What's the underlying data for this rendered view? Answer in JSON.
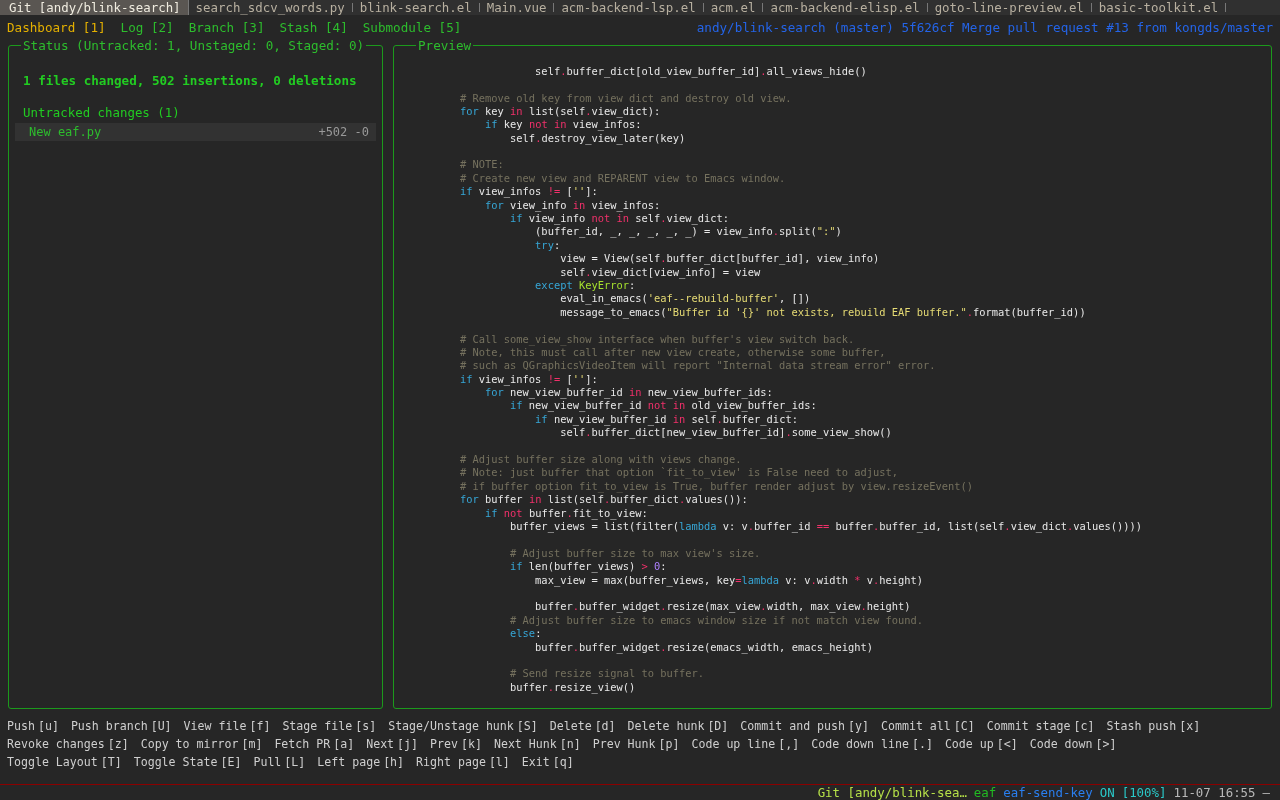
{
  "tabs": [
    {
      "label": "Git [andy/blink-search]",
      "selected": true
    },
    {
      "label": "search_sdcv_words.py",
      "selected": false
    },
    {
      "label": "blink-search.el",
      "selected": false
    },
    {
      "label": "Main.vue",
      "selected": false
    },
    {
      "label": "acm-backend-lsp.el",
      "selected": false
    },
    {
      "label": "acm.el",
      "selected": false
    },
    {
      "label": "acm-backend-elisp.el",
      "selected": false
    },
    {
      "label": "goto-line-preview.el",
      "selected": false
    },
    {
      "label": "basic-toolkit.el",
      "selected": false
    }
  ],
  "menu": [
    {
      "label": "Dashboard [1]",
      "selected": true
    },
    {
      "label": "Log [2]",
      "selected": false
    },
    {
      "label": "Branch [3]",
      "selected": false
    },
    {
      "label": "Stash [4]",
      "selected": false
    },
    {
      "label": "Submodule [5]",
      "selected": false
    }
  ],
  "commit_info": "andy/blink-search (master) 5f626cf Merge pull request #13 from kongds/master",
  "status": {
    "title": "Status (Untracked: 1, Unstaged: 0, Staged: 0)",
    "summary": "1 files changed, 502 insertions, 0 deletions",
    "sections": [
      {
        "heading": "Untracked changes (1)",
        "files": [
          {
            "name": "New eaf.py",
            "stat": "+502 -0",
            "selected": true
          }
        ]
      }
    ]
  },
  "preview": {
    "title": "Preview",
    "lines": [
      {
        "kind": "code",
        "tokens": [
          {
            "t": "                    self",
            "kind": "plain"
          },
          {
            "t": ".",
            "kind": "operator"
          },
          {
            "t": "buffer_dict[old_view_buffer_id]",
            "kind": "plain"
          },
          {
            "t": ".",
            "kind": "operator"
          },
          {
            "t": "all_views_hide()",
            "kind": "plain"
          }
        ]
      },
      {
        "kind": "blank"
      },
      {
        "kind": "code",
        "tokens": [
          {
            "t": "        # Remove old key from view dict and destroy old view.",
            "kind": "comment"
          }
        ]
      },
      {
        "kind": "code",
        "tokens": [
          {
            "t": "        for",
            "kind": "keyword"
          },
          {
            "t": " key ",
            "kind": "plain"
          },
          {
            "t": "in",
            "kind": "operator"
          },
          {
            "t": " list(self",
            "kind": "plain"
          },
          {
            "t": ".",
            "kind": "operator"
          },
          {
            "t": "view_dict):",
            "kind": "plain"
          }
        ]
      },
      {
        "kind": "code",
        "tokens": [
          {
            "t": "            if",
            "kind": "keyword"
          },
          {
            "t": " key ",
            "kind": "plain"
          },
          {
            "t": "not in",
            "kind": "operator"
          },
          {
            "t": " view_infos:",
            "kind": "plain"
          }
        ]
      },
      {
        "kind": "code",
        "tokens": [
          {
            "t": "                self",
            "kind": "plain"
          },
          {
            "t": ".",
            "kind": "operator"
          },
          {
            "t": "destroy_view_later(key)",
            "kind": "plain"
          }
        ]
      },
      {
        "kind": "blank"
      },
      {
        "kind": "code",
        "tokens": [
          {
            "t": "        # NOTE:",
            "kind": "comment"
          }
        ]
      },
      {
        "kind": "code",
        "tokens": [
          {
            "t": "        # Create new view and REPARENT view to Emacs window.",
            "kind": "comment"
          }
        ]
      },
      {
        "kind": "code",
        "tokens": [
          {
            "t": "        if",
            "kind": "keyword"
          },
          {
            "t": " view_infos ",
            "kind": "plain"
          },
          {
            "t": "!=",
            "kind": "operator"
          },
          {
            "t": " [",
            "kind": "plain"
          },
          {
            "t": "''",
            "kind": "string"
          },
          {
            "t": "]:",
            "kind": "plain"
          }
        ]
      },
      {
        "kind": "code",
        "tokens": [
          {
            "t": "            for",
            "kind": "keyword"
          },
          {
            "t": " view_info ",
            "kind": "plain"
          },
          {
            "t": "in",
            "kind": "operator"
          },
          {
            "t": " view_infos:",
            "kind": "plain"
          }
        ]
      },
      {
        "kind": "code",
        "tokens": [
          {
            "t": "                if",
            "kind": "keyword"
          },
          {
            "t": " view_info ",
            "kind": "plain"
          },
          {
            "t": "not in",
            "kind": "operator"
          },
          {
            "t": " self",
            "kind": "plain"
          },
          {
            "t": ".",
            "kind": "operator"
          },
          {
            "t": "view_dict:",
            "kind": "plain"
          }
        ]
      },
      {
        "kind": "code",
        "tokens": [
          {
            "t": "                    (buffer_id, _, _, _, _, _) = view_info",
            "kind": "plain"
          },
          {
            "t": ".",
            "kind": "operator"
          },
          {
            "t": "split(",
            "kind": "plain"
          },
          {
            "t": "\":\"",
            "kind": "string"
          },
          {
            "t": ")",
            "kind": "plain"
          }
        ]
      },
      {
        "kind": "code",
        "tokens": [
          {
            "t": "                    try",
            "kind": "keyword"
          },
          {
            "t": ":",
            "kind": "plain"
          }
        ]
      },
      {
        "kind": "code",
        "tokens": [
          {
            "t": "                        view = View(self",
            "kind": "plain"
          },
          {
            "t": ".",
            "kind": "operator"
          },
          {
            "t": "buffer_dict[buffer_id], view_info)",
            "kind": "plain"
          }
        ]
      },
      {
        "kind": "code",
        "tokens": [
          {
            "t": "                        self",
            "kind": "plain"
          },
          {
            "t": ".",
            "kind": "operator"
          },
          {
            "t": "view_dict[view_info] = view",
            "kind": "plain"
          }
        ]
      },
      {
        "kind": "code",
        "tokens": [
          {
            "t": "                    except ",
            "kind": "keyword"
          },
          {
            "t": "KeyError",
            "kind": "type"
          },
          {
            "t": ":",
            "kind": "plain"
          }
        ]
      },
      {
        "kind": "code",
        "tokens": [
          {
            "t": "                        eval_in_emacs(",
            "kind": "plain"
          },
          {
            "t": "'eaf--rebuild-buffer'",
            "kind": "string"
          },
          {
            "t": ", [])",
            "kind": "plain"
          }
        ]
      },
      {
        "kind": "code",
        "tokens": [
          {
            "t": "                        message_to_emacs(",
            "kind": "plain"
          },
          {
            "t": "\"Buffer id '{}' not exists, rebuild EAF buffer.\"",
            "kind": "string"
          },
          {
            "t": ".",
            "kind": "operator"
          },
          {
            "t": "format(buffer_id))",
            "kind": "plain"
          }
        ]
      },
      {
        "kind": "blank"
      },
      {
        "kind": "code",
        "tokens": [
          {
            "t": "        # Call some_view_show interface when buffer's view switch back.",
            "kind": "comment"
          }
        ]
      },
      {
        "kind": "code",
        "tokens": [
          {
            "t": "        # Note, this must call after new view create, otherwise some buffer,",
            "kind": "comment"
          }
        ]
      },
      {
        "kind": "code",
        "tokens": [
          {
            "t": "        # such as QGraphicsVideoItem will report \"Internal data stream error\" error.",
            "kind": "comment"
          }
        ]
      },
      {
        "kind": "code",
        "tokens": [
          {
            "t": "        if",
            "kind": "keyword"
          },
          {
            "t": " view_infos ",
            "kind": "plain"
          },
          {
            "t": "!=",
            "kind": "operator"
          },
          {
            "t": " [",
            "kind": "plain"
          },
          {
            "t": "''",
            "kind": "string"
          },
          {
            "t": "]:",
            "kind": "plain"
          }
        ]
      },
      {
        "kind": "code",
        "tokens": [
          {
            "t": "            for",
            "kind": "keyword"
          },
          {
            "t": " new_view_buffer_id ",
            "kind": "plain"
          },
          {
            "t": "in",
            "kind": "operator"
          },
          {
            "t": " new_view_buffer_ids:",
            "kind": "plain"
          }
        ]
      },
      {
        "kind": "code",
        "tokens": [
          {
            "t": "                if",
            "kind": "keyword"
          },
          {
            "t": " new_view_buffer_id ",
            "kind": "plain"
          },
          {
            "t": "not in",
            "kind": "operator"
          },
          {
            "t": " old_view_buffer_ids:",
            "kind": "plain"
          }
        ]
      },
      {
        "kind": "code",
        "tokens": [
          {
            "t": "                    if",
            "kind": "keyword"
          },
          {
            "t": " new_view_buffer_id ",
            "kind": "plain"
          },
          {
            "t": "in",
            "kind": "operator"
          },
          {
            "t": " self",
            "kind": "plain"
          },
          {
            "t": ".",
            "kind": "operator"
          },
          {
            "t": "buffer_dict:",
            "kind": "plain"
          }
        ]
      },
      {
        "kind": "code",
        "tokens": [
          {
            "t": "                        self",
            "kind": "plain"
          },
          {
            "t": ".",
            "kind": "operator"
          },
          {
            "t": "buffer_dict[new_view_buffer_id]",
            "kind": "plain"
          },
          {
            "t": ".",
            "kind": "operator"
          },
          {
            "t": "some_view_show()",
            "kind": "plain"
          }
        ]
      },
      {
        "kind": "blank"
      },
      {
        "kind": "code",
        "tokens": [
          {
            "t": "        # Adjust buffer size along with views change.",
            "kind": "comment"
          }
        ]
      },
      {
        "kind": "code",
        "tokens": [
          {
            "t": "        # Note: just buffer that option `fit_to_view' is False need to adjust,",
            "kind": "comment"
          }
        ]
      },
      {
        "kind": "code",
        "tokens": [
          {
            "t": "        # if buffer option fit_to_view is True, buffer render adjust by view.resizeEvent()",
            "kind": "comment"
          }
        ]
      },
      {
        "kind": "code",
        "tokens": [
          {
            "t": "        for",
            "kind": "keyword"
          },
          {
            "t": " buffer ",
            "kind": "plain"
          },
          {
            "t": "in",
            "kind": "operator"
          },
          {
            "t": " list(self",
            "kind": "plain"
          },
          {
            "t": ".",
            "kind": "operator"
          },
          {
            "t": "buffer_dict",
            "kind": "plain"
          },
          {
            "t": ".",
            "kind": "operator"
          },
          {
            "t": "values()):",
            "kind": "plain"
          }
        ]
      },
      {
        "kind": "code",
        "tokens": [
          {
            "t": "            if ",
            "kind": "keyword"
          },
          {
            "t": "not",
            "kind": "operator"
          },
          {
            "t": " buffer",
            "kind": "plain"
          },
          {
            "t": ".",
            "kind": "operator"
          },
          {
            "t": "fit_to_view:",
            "kind": "plain"
          }
        ]
      },
      {
        "kind": "code",
        "tokens": [
          {
            "t": "                buffer_views = list(filter(",
            "kind": "plain"
          },
          {
            "t": "lambda",
            "kind": "keyword"
          },
          {
            "t": " v: v",
            "kind": "plain"
          },
          {
            "t": ".",
            "kind": "operator"
          },
          {
            "t": "buffer_id ",
            "kind": "plain"
          },
          {
            "t": "==",
            "kind": "operator"
          },
          {
            "t": " buffer",
            "kind": "plain"
          },
          {
            "t": ".",
            "kind": "operator"
          },
          {
            "t": "buffer_id, list(self",
            "kind": "plain"
          },
          {
            "t": ".",
            "kind": "operator"
          },
          {
            "t": "view_dict",
            "kind": "plain"
          },
          {
            "t": ".",
            "kind": "operator"
          },
          {
            "t": "values())))",
            "kind": "plain"
          }
        ]
      },
      {
        "kind": "blank"
      },
      {
        "kind": "code",
        "tokens": [
          {
            "t": "                # Adjust buffer size to max view's size.",
            "kind": "comment"
          }
        ]
      },
      {
        "kind": "code",
        "tokens": [
          {
            "t": "                if",
            "kind": "keyword"
          },
          {
            "t": " len(buffer_views) ",
            "kind": "plain"
          },
          {
            "t": "> ",
            "kind": "operator"
          },
          {
            "t": "0",
            "kind": "number"
          },
          {
            "t": ":",
            "kind": "plain"
          }
        ]
      },
      {
        "kind": "code",
        "tokens": [
          {
            "t": "                    max_view = max(buffer_views, key",
            "kind": "plain"
          },
          {
            "t": "=",
            "kind": "operator"
          },
          {
            "t": "lambda",
            "kind": "keyword"
          },
          {
            "t": " v: v",
            "kind": "plain"
          },
          {
            "t": ".",
            "kind": "operator"
          },
          {
            "t": "width ",
            "kind": "plain"
          },
          {
            "t": "*",
            "kind": "operator"
          },
          {
            "t": " v",
            "kind": "plain"
          },
          {
            "t": ".",
            "kind": "operator"
          },
          {
            "t": "height)",
            "kind": "plain"
          }
        ]
      },
      {
        "kind": "blank"
      },
      {
        "kind": "code",
        "tokens": [
          {
            "t": "                    buffer",
            "kind": "plain"
          },
          {
            "t": ".",
            "kind": "operator"
          },
          {
            "t": "buffer_widget",
            "kind": "plain"
          },
          {
            "t": ".",
            "kind": "operator"
          },
          {
            "t": "resize(max_view",
            "kind": "plain"
          },
          {
            "t": ".",
            "kind": "operator"
          },
          {
            "t": "width, max_view",
            "kind": "plain"
          },
          {
            "t": ".",
            "kind": "operator"
          },
          {
            "t": "height)",
            "kind": "plain"
          }
        ]
      },
      {
        "kind": "code",
        "tokens": [
          {
            "t": "                # Adjust buffer size to emacs window size if not match view found.",
            "kind": "comment"
          }
        ]
      },
      {
        "kind": "code",
        "tokens": [
          {
            "t": "                else",
            "kind": "keyword"
          },
          {
            "t": ":",
            "kind": "plain"
          }
        ]
      },
      {
        "kind": "code",
        "tokens": [
          {
            "t": "                    buffer",
            "kind": "plain"
          },
          {
            "t": ".",
            "kind": "operator"
          },
          {
            "t": "buffer_widget",
            "kind": "plain"
          },
          {
            "t": ".",
            "kind": "operator"
          },
          {
            "t": "resize(emacs_width, emacs_height)",
            "kind": "plain"
          }
        ]
      },
      {
        "kind": "blank"
      },
      {
        "kind": "code",
        "tokens": [
          {
            "t": "                # Send resize signal to buffer.",
            "kind": "comment"
          }
        ]
      },
      {
        "kind": "code",
        "tokens": [
          {
            "t": "                buffer",
            "kind": "plain"
          },
          {
            "t": ".",
            "kind": "operator"
          },
          {
            "t": "resize_view()",
            "kind": "plain"
          }
        ]
      }
    ]
  },
  "key_hints": [
    [
      {
        "label": "Push",
        "key": "[u]"
      },
      {
        "label": "Push branch",
        "key": "[U]"
      },
      {
        "label": "View file",
        "key": "[f]"
      },
      {
        "label": "Stage file",
        "key": "[s]"
      },
      {
        "label": "Stage/Unstage hunk",
        "key": "[S]"
      },
      {
        "label": "Delete",
        "key": "[d]"
      },
      {
        "label": "Delete hunk",
        "key": "[D]"
      },
      {
        "label": "Commit and push",
        "key": "[y]"
      },
      {
        "label": "Commit all",
        "key": "[C]"
      },
      {
        "label": "Commit stage",
        "key": "[c]"
      },
      {
        "label": "Stash push",
        "key": "[x]"
      }
    ],
    [
      {
        "label": "Revoke changes",
        "key": "[z]"
      },
      {
        "label": "Copy to mirror",
        "key": "[m]"
      },
      {
        "label": "Fetch PR",
        "key": "[a]"
      },
      {
        "label": "Next",
        "key": "[j]"
      },
      {
        "label": "Prev",
        "key": "[k]"
      },
      {
        "label": "Next Hunk",
        "key": "[n]"
      },
      {
        "label": "Prev Hunk",
        "key": "[p]"
      },
      {
        "label": "Code up line",
        "key": "[,]"
      },
      {
        "label": "Code down line",
        "key": "[.]"
      },
      {
        "label": "Code up",
        "key": "[<]"
      },
      {
        "label": "Code down",
        "key": "[>]"
      }
    ],
    [
      {
        "label": "Toggle Layout",
        "key": "[T]"
      },
      {
        "label": "Toggle State",
        "key": "[E]"
      },
      {
        "label": "Pull",
        "key": "[L]"
      },
      {
        "label": "Left page",
        "key": "[h]"
      },
      {
        "label": "Right page",
        "key": "[l]"
      },
      {
        "label": "Exit",
        "key": "[q]"
      }
    ]
  ],
  "mode_line": [
    {
      "text": "Git [andy/blink-sea…",
      "kind": "buffer"
    },
    {
      "text": "eaf",
      "kind": "mode"
    },
    {
      "text": "eaf-send-key",
      "kind": "command"
    },
    {
      "text": "ON",
      "kind": "state"
    },
    {
      "text": "[100%]",
      "kind": "percent"
    },
    {
      "text": "11-07 16:55",
      "kind": "time"
    },
    {
      "text": "—",
      "kind": "dash"
    }
  ]
}
